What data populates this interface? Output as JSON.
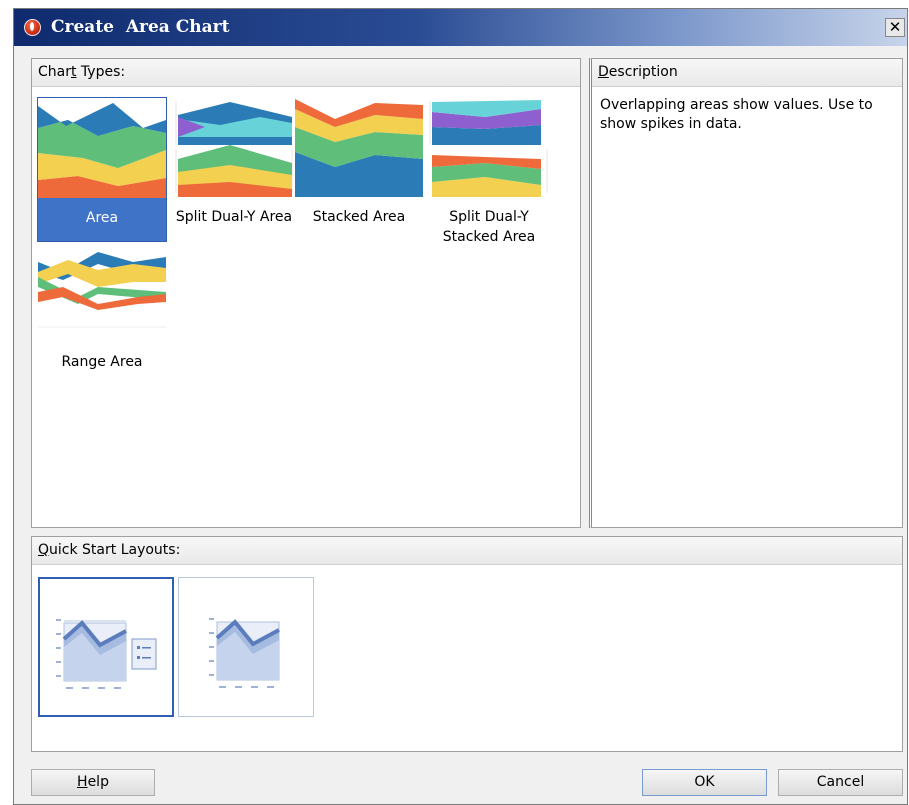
{
  "window": {
    "title": "Create  Area Chart",
    "close_label": "✕"
  },
  "chart_types": {
    "header_prefix": "Char",
    "header_mnemonic": "t",
    "header_suffix": " Types:",
    "items": [
      {
        "label": "Area",
        "selected": true
      },
      {
        "label": "Split Dual-Y Area"
      },
      {
        "label": "Stacked Area"
      },
      {
        "label": "Split Dual-Y Stacked Area"
      },
      {
        "label": "Range Area"
      }
    ]
  },
  "description": {
    "header_mnemonic": "D",
    "header_suffix": "escription",
    "text": "Overlapping areas show values. Use to show spikes in data."
  },
  "quick_start": {
    "header_mnemonic": "Q",
    "header_suffix": "uick Start Layouts:",
    "layouts": [
      {
        "name": "layout-with-legend",
        "selected": true
      },
      {
        "name": "layout-no-legend"
      }
    ]
  },
  "buttons": {
    "help_mnemonic": "H",
    "help_suffix": "elp",
    "ok": "OK",
    "cancel": "Cancel"
  },
  "colors": {
    "blue": "#2a7bb6",
    "teal": "#67d3d8",
    "green": "#5fbf7a",
    "yellow": "#f3d050",
    "orange": "#ee6a3b",
    "purple": "#8e5fcf",
    "selection": "#3f73c7"
  }
}
